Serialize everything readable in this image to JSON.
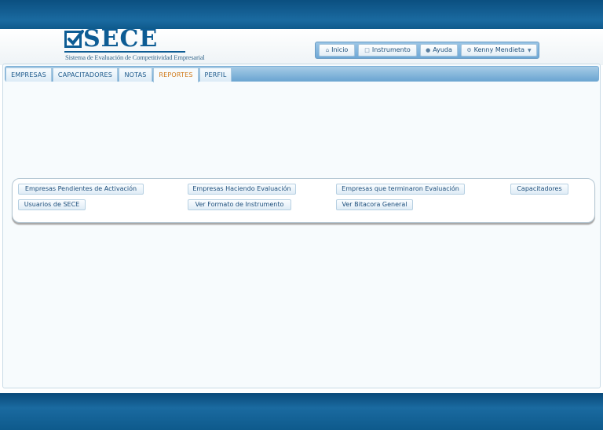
{
  "logo": {
    "title": "SECE",
    "subtitle": "Sistema de Evaluación de Competitividad Empresarial"
  },
  "topnav": {
    "inicio": "Inicio",
    "instrumento": "Instrumento",
    "ayuda": "Ayuda",
    "user": "Kenny Mendieta",
    "icons": {
      "inicio": "home-icon",
      "instrumento": "document-icon",
      "ayuda": "info-icon",
      "user": "gear-icon",
      "user_caret": "chevron-down-icon"
    }
  },
  "tabs": [
    {
      "label": "EMPRESAS"
    },
    {
      "label": "CAPACITADORES"
    },
    {
      "label": "NOTAS"
    },
    {
      "label": "REPORTES"
    },
    {
      "label": "PERFIL"
    }
  ],
  "active_tab": "REPORTES",
  "reports": {
    "row1": [
      "Empresas Pendientes de Activación",
      "Empresas Haciendo Evaluación",
      "Empresas que terminaron Evaluación",
      "Capacitadores"
    ],
    "row2": [
      "Usuarios de SECE",
      "Ver Formato de Instrumento",
      "Ver Bitacora General"
    ]
  },
  "colors": {
    "brand": "#0d5c94",
    "active_tab_text": "#d07a1a",
    "band": "#1a6aa0"
  }
}
